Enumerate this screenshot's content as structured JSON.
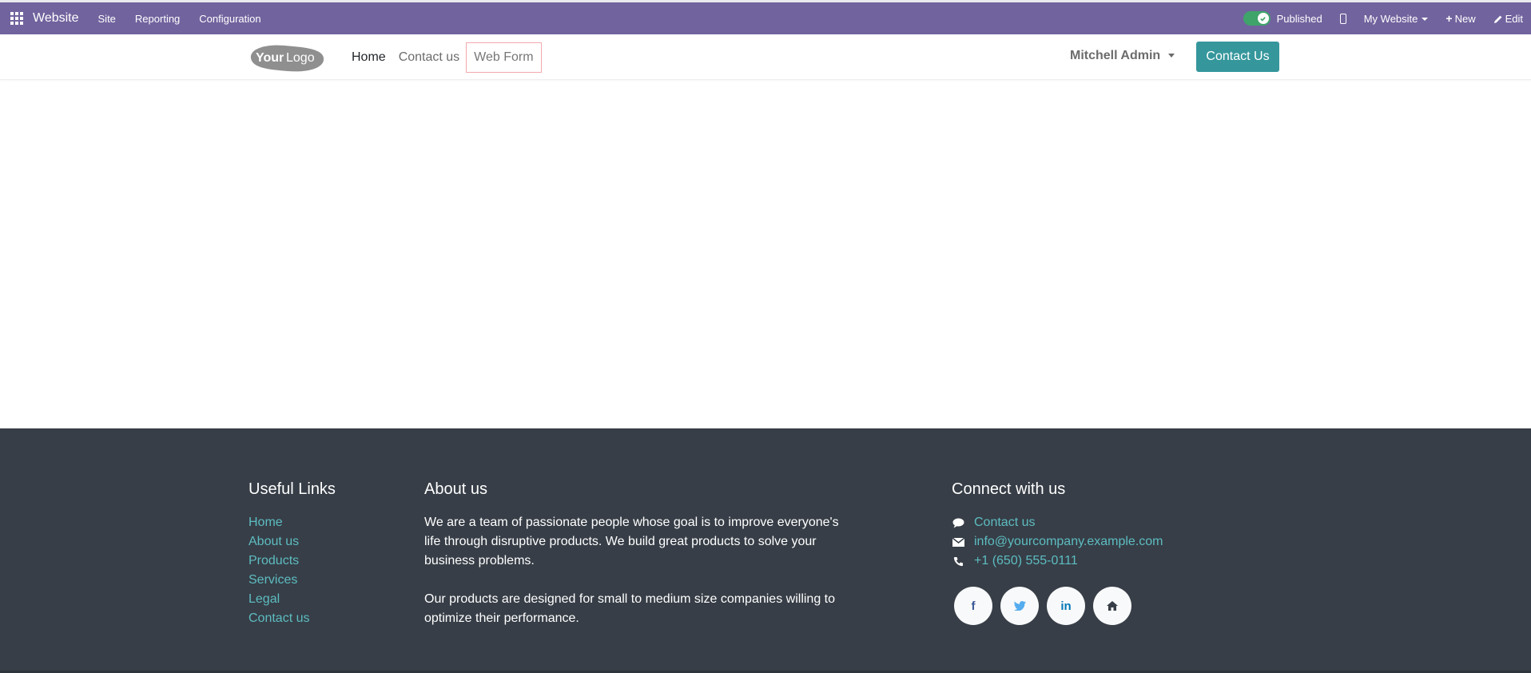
{
  "topbar": {
    "app_name": "Website",
    "menu": [
      "Site",
      "Reporting",
      "Configuration"
    ],
    "published_label": "Published",
    "published": true,
    "website_selector": "My Website",
    "new_label": "New",
    "edit_label": "Edit"
  },
  "header": {
    "logo_text_bold": "Your",
    "logo_text_light": "Logo",
    "nav": [
      "Home",
      "Contact us",
      "Web Form"
    ],
    "user_name": "Mitchell Admin",
    "cta_label": "Contact Us"
  },
  "footer": {
    "useful_links": {
      "title": "Useful Links",
      "items": [
        "Home",
        "About us",
        "Products",
        "Services",
        "Legal",
        "Contact us"
      ]
    },
    "about": {
      "title": "About us",
      "paragraphs": [
        "We are a team of passionate people whose goal is to improve everyone's life through disruptive products. We build great products to solve your business problems.",
        "Our products are designed for small to medium size companies willing to optimize their performance."
      ]
    },
    "connect": {
      "title": "Connect with us",
      "contact_label": "Contact us",
      "email": "info@yourcompany.example.com",
      "phone": "+1 (650) 555-0111",
      "socials": [
        "facebook",
        "twitter",
        "linkedin",
        "home"
      ]
    }
  },
  "colors": {
    "admin_bar": "#71639e",
    "primary": "#35979c",
    "footer_bg": "#373e47",
    "footer_link": "#5dbcc1",
    "toggle_on": "#3fa46a"
  }
}
